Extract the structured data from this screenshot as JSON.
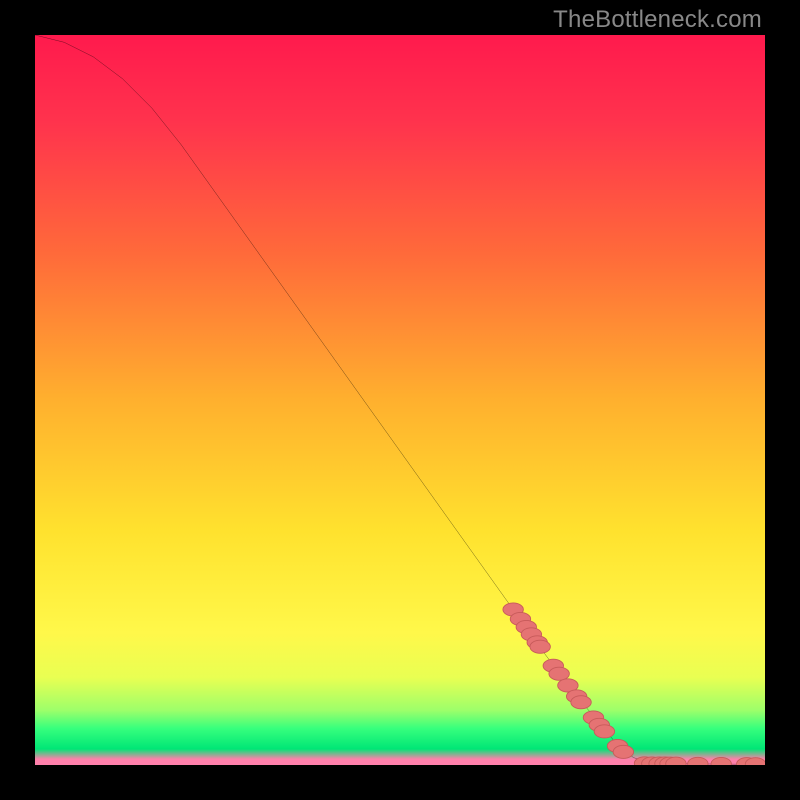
{
  "watermark": "TheBottleneck.com",
  "colors": {
    "curve": "#000000",
    "marker_fill": "#e57373",
    "marker_stroke": "#c75a5a",
    "background_black": "#000000"
  },
  "chart_data": {
    "type": "line",
    "title": "",
    "xlabel": "",
    "ylabel": "",
    "xlim": [
      0,
      100
    ],
    "ylim": [
      0,
      100
    ],
    "curve": [
      {
        "x": 0,
        "y": 100
      },
      {
        "x": 4,
        "y": 99
      },
      {
        "x": 8,
        "y": 97
      },
      {
        "x": 12,
        "y": 94
      },
      {
        "x": 16,
        "y": 90
      },
      {
        "x": 20,
        "y": 85
      },
      {
        "x": 25,
        "y": 78
      },
      {
        "x": 30,
        "y": 71
      },
      {
        "x": 35,
        "y": 64
      },
      {
        "x": 40,
        "y": 57
      },
      {
        "x": 45,
        "y": 50
      },
      {
        "x": 50,
        "y": 43
      },
      {
        "x": 55,
        "y": 36
      },
      {
        "x": 60,
        "y": 29
      },
      {
        "x": 65,
        "y": 22
      },
      {
        "x": 70,
        "y": 15
      },
      {
        "x": 75,
        "y": 8.5
      },
      {
        "x": 80,
        "y": 2.5
      },
      {
        "x": 82,
        "y": 1
      },
      {
        "x": 85,
        "y": 0.2
      },
      {
        "x": 90,
        "y": 0.15
      },
      {
        "x": 95,
        "y": 0.12
      },
      {
        "x": 100,
        "y": 0.1
      }
    ],
    "markers": [
      {
        "x": 65.5,
        "y": 21.3
      },
      {
        "x": 66.5,
        "y": 20.0
      },
      {
        "x": 67.3,
        "y": 18.9
      },
      {
        "x": 68.0,
        "y": 17.9
      },
      {
        "x": 68.8,
        "y": 16.8
      },
      {
        "x": 69.2,
        "y": 16.2
      },
      {
        "x": 71.0,
        "y": 13.6
      },
      {
        "x": 71.8,
        "y": 12.5
      },
      {
        "x": 73.0,
        "y": 10.9
      },
      {
        "x": 74.2,
        "y": 9.4
      },
      {
        "x": 74.8,
        "y": 8.6
      },
      {
        "x": 76.5,
        "y": 6.5
      },
      {
        "x": 77.3,
        "y": 5.5
      },
      {
        "x": 78.0,
        "y": 4.6
      },
      {
        "x": 79.8,
        "y": 2.6
      },
      {
        "x": 80.6,
        "y": 1.8
      },
      {
        "x": 83.5,
        "y": 0.22
      },
      {
        "x": 84.5,
        "y": 0.21
      },
      {
        "x": 85.5,
        "y": 0.2
      },
      {
        "x": 86.3,
        "y": 0.2
      },
      {
        "x": 87.0,
        "y": 0.19
      },
      {
        "x": 87.8,
        "y": 0.18
      },
      {
        "x": 90.8,
        "y": 0.16
      },
      {
        "x": 94.0,
        "y": 0.14
      },
      {
        "x": 97.5,
        "y": 0.12
      },
      {
        "x": 98.7,
        "y": 0.11
      }
    ],
    "marker_rx": 1.4,
    "marker_ry": 0.9
  }
}
